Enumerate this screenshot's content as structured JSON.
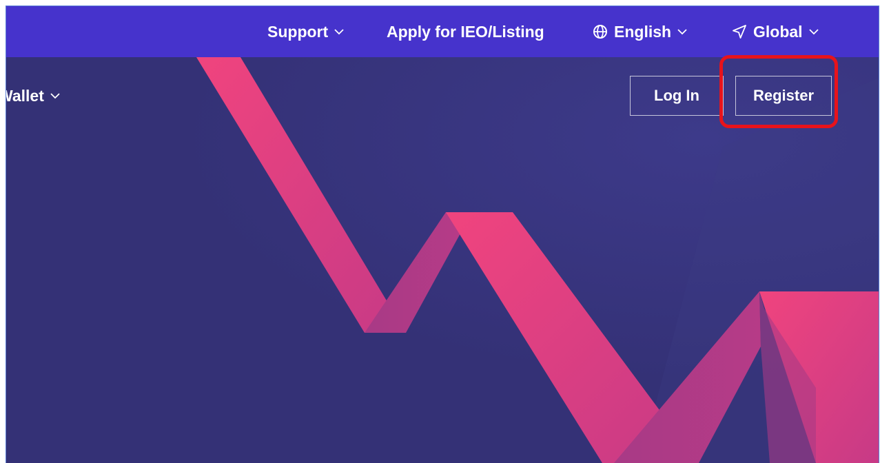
{
  "topbar": {
    "support_label": "Support",
    "apply_label": "Apply for IEO/Listing",
    "language_label": "English",
    "region_label": "Global"
  },
  "nav": {
    "wallet_label": "Wallet"
  },
  "auth": {
    "login_label": "Log In",
    "register_label": "Register"
  },
  "colors": {
    "topbar": "#4633cc",
    "hero_background": "#363277",
    "ribbon": "#e63d86",
    "highlight": "#e8131b"
  }
}
